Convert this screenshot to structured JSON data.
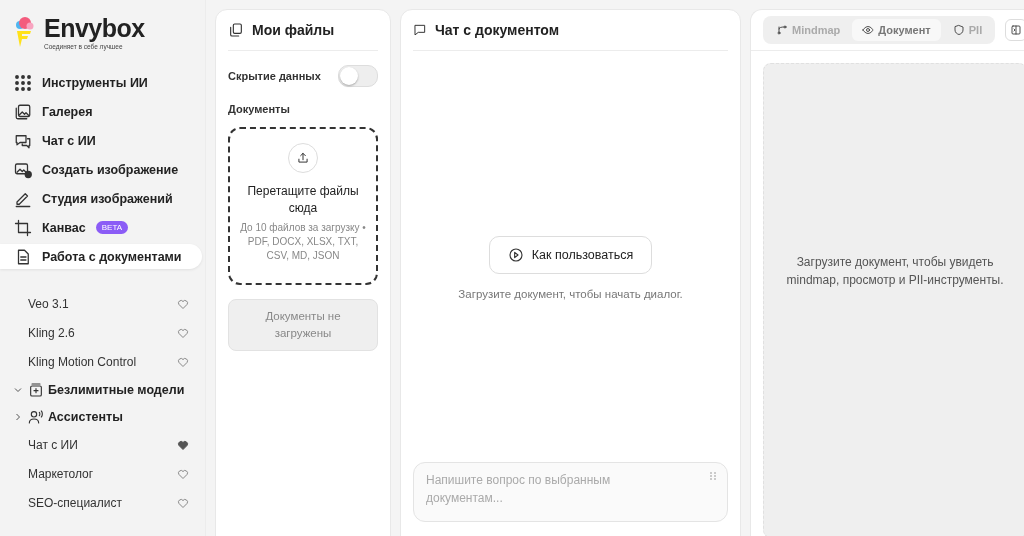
{
  "brand": {
    "name": "Envybox",
    "tagline": "Соединяет в себе лучшее"
  },
  "nav": [
    {
      "label": "Инструменты ИИ",
      "selected": false
    },
    {
      "label": "Галерея",
      "selected": false
    },
    {
      "label": "Чат с ИИ",
      "selected": false
    },
    {
      "label": "Создать изображение",
      "selected": false
    },
    {
      "label": "Студия изображений",
      "selected": false
    },
    {
      "label": "Канвас",
      "badge": "BETA",
      "selected": false
    },
    {
      "label": "Работа с документами",
      "selected": true
    }
  ],
  "models": [
    {
      "kind": "item",
      "label": "Veo 3.1",
      "favorite": false
    },
    {
      "kind": "item",
      "label": "Kling 2.6",
      "favorite": false
    },
    {
      "kind": "item",
      "label": "Kling Motion Control",
      "favorite": false
    },
    {
      "kind": "group",
      "label": "Безлимитные модели",
      "expanded": true
    },
    {
      "kind": "group",
      "label": "Ассистенты",
      "expanded": false
    },
    {
      "kind": "item",
      "label": "Чат с ИИ",
      "favorite": true
    },
    {
      "kind": "item",
      "label": "Маркетолог",
      "favorite": false
    },
    {
      "kind": "item",
      "label": "SEO-специалист",
      "favorite": false
    }
  ],
  "files": {
    "title": "Мои файлы",
    "toggle": {
      "label": "Скрытие данных",
      "on": false
    },
    "section": "Документы",
    "drop_title": "Перетащите файлы сюда",
    "drop_hint": "До 10 файлов за загрузку • PDF, DOCX, XLSX, TXT, CSV, MD, JSON",
    "empty": "Документы не загружены"
  },
  "chat": {
    "title": "Чат с документом",
    "help_button": "Как пользоваться",
    "hint": "Загрузите документ, чтобы начать диалог.",
    "input": {
      "placeholder": "Напишите вопрос по выбранным документам..."
    }
  },
  "viewer": {
    "tabs": [
      {
        "label": "Mindmap",
        "selected": false
      },
      {
        "label": "Документ",
        "selected": true
      },
      {
        "label": "PII",
        "selected": false
      }
    ],
    "hint": "Загрузите документ, чтобы увидеть mindmap, просмотр и PII-инструменты."
  }
}
